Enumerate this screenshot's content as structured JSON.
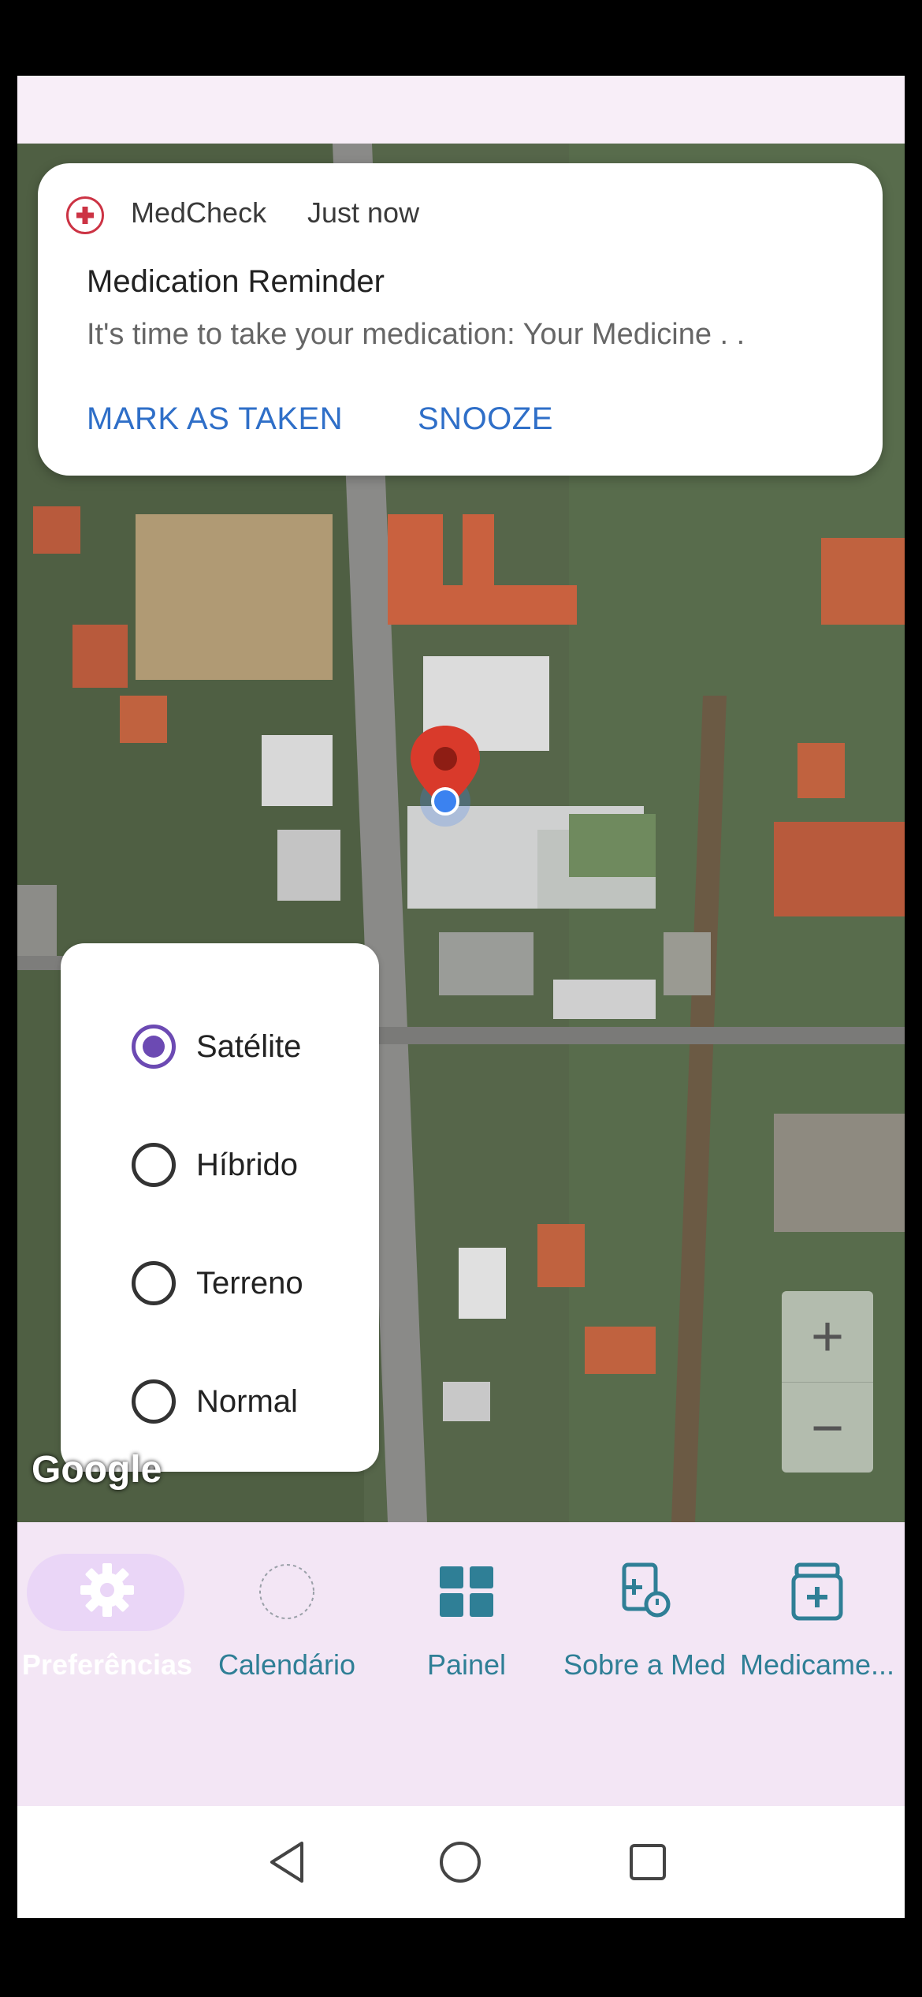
{
  "notification": {
    "app_name": "MedCheck",
    "time": "Just now",
    "title": "Medication Reminder",
    "body": "It's time to take your medication: Your Medicine . .",
    "actions": [
      "MARK AS TAKEN",
      "SNOOZE"
    ]
  },
  "map": {
    "attribution": "Google",
    "map_types": [
      {
        "label": "Satélite",
        "selected": true
      },
      {
        "label": "Híbrido",
        "selected": false
      },
      {
        "label": "Terreno",
        "selected": false
      },
      {
        "label": "Normal",
        "selected": false
      }
    ],
    "zoom_in_label": "+",
    "zoom_out_label": "−"
  },
  "nav": {
    "items": [
      {
        "label": "Preferências",
        "icon": "gear-icon",
        "active": true
      },
      {
        "label": "Calendário",
        "icon": "calendar-icon",
        "active": false
      },
      {
        "label": "Painel",
        "icon": "dashboard-icon",
        "active": false
      },
      {
        "label": "Sobre a Med",
        "icon": "medicine-info-icon",
        "active": false
      },
      {
        "label": "Medicame...",
        "icon": "medicine-box-icon",
        "active": false
      }
    ]
  },
  "colors": {
    "accent": "#6c4ab3",
    "nav_text": "#2f7f96",
    "action_text": "#2f6fc8",
    "marker": "#d93a2b"
  }
}
